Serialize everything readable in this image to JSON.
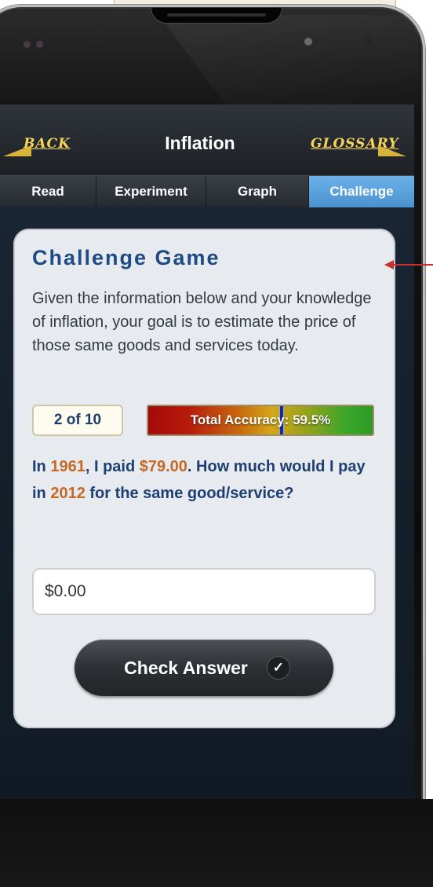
{
  "nav": {
    "back_label": "BACK",
    "title": "Inflation",
    "glossary_label": "GLOSSARY"
  },
  "tabs": [
    {
      "label": "Read",
      "active": false
    },
    {
      "label": "Experiment",
      "active": false
    },
    {
      "label": "Graph",
      "active": false
    },
    {
      "label": "Challenge",
      "active": true
    }
  ],
  "challenge": {
    "title": "Challenge Game",
    "intro": "Given the information below and your knowledge of inflation, your goal is to estimate the price of those same goods and services today.",
    "counter": "2 of 10",
    "accuracy_label": "Total Accuracy: 59.5%",
    "accuracy_percent": 59.5,
    "question": {
      "part1": "In ",
      "year_from": "1961",
      "part2": ", I paid ",
      "amount": "$79.00",
      "part3": ". How much would I pay in ",
      "year_to": "2012",
      "part4": " for the same good/service?"
    },
    "answer_value": "$0.00",
    "check_button_label": "Check Answer",
    "check_icon": "✓"
  },
  "colors": {
    "accent_blue": "#4a92cf",
    "title_blue": "#1e4b86",
    "highlight_orange": "#c56a25",
    "nav_gold": "#f6d55a",
    "annotation_red": "#c8302c"
  }
}
